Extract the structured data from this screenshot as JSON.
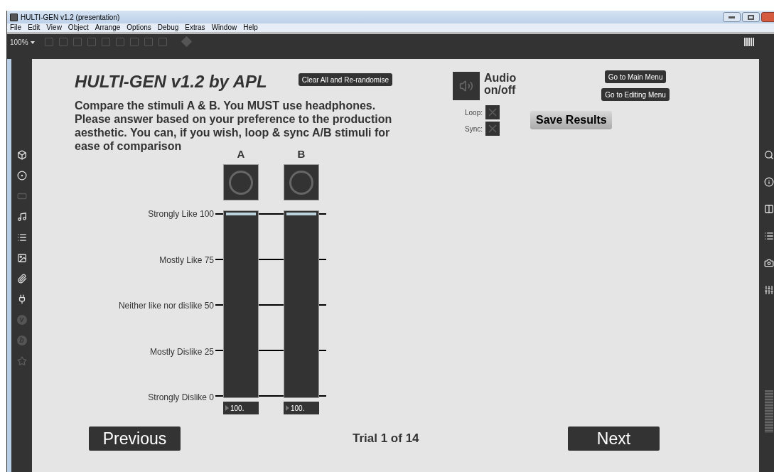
{
  "window": {
    "title": "HULTI-GEN v1.2 (presentation)"
  },
  "menu": [
    "File",
    "Edit",
    "View",
    "Object",
    "Arrange",
    "Options",
    "Debug",
    "Extras",
    "Window",
    "Help"
  ],
  "toolbar": {
    "zoom": "100%"
  },
  "left_sidebar": {
    "badges": [
      "v",
      "b"
    ]
  },
  "page": {
    "title": "HULTI-GEN v1.2 by APL",
    "clear_button": "Clear All and Re-randomise",
    "instructions": "Compare the stimuli A & B. You MUST use headphones.\nPlease answer based on your preference to the production\naesthetic. You can, if you wish, loop & sync A/B stimuli for\nease of comparison",
    "audio_label": "Audio\non/off",
    "toggles": [
      {
        "label": "Loop:",
        "checked": false
      },
      {
        "label": "Sync:",
        "checked": false
      }
    ],
    "menu_buttons": [
      "Go to Main Menu",
      "Go to Editing Menu"
    ],
    "save_button": "Save Results",
    "scale": [
      "Strongly Like 100",
      "Mostly Like 75",
      "Neither like nor dislike 50",
      "Mostly Dislike 25",
      "Strongly Dislike 0"
    ],
    "stimuli": [
      {
        "label": "A",
        "level": 1,
        "value": "100."
      },
      {
        "label": "B",
        "level": 1,
        "value": "100."
      }
    ],
    "previous_button": "Previous",
    "trial": "Trial 1 of 14",
    "next_button": "Next"
  }
}
